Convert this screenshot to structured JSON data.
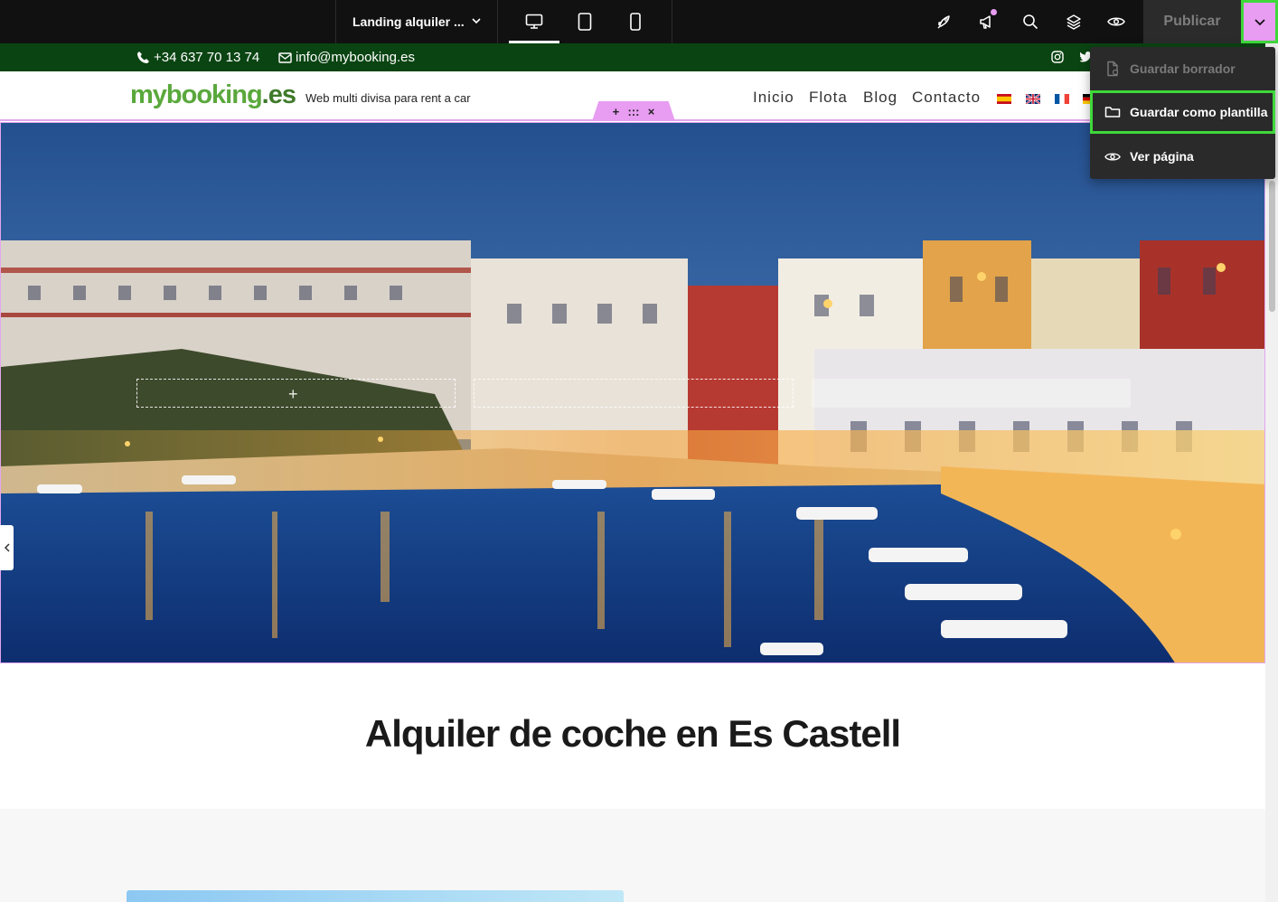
{
  "editor": {
    "page_selector": "Landing alquiler ...",
    "publish_label": "Publicar",
    "menu": [
      {
        "label": "Guardar borrador",
        "disabled": true,
        "icon": "file-icon"
      },
      {
        "label": "Guardar como plantilla",
        "highlighted": true,
        "icon": "folder-icon"
      },
      {
        "label": "Ver página",
        "icon": "eye-icon"
      }
    ],
    "tools": [
      "rocket-icon",
      "megaphone-icon",
      "search-icon",
      "layers-icon",
      "eye-icon"
    ],
    "devices": [
      "desktop-icon",
      "tablet-icon",
      "mobile-icon"
    ],
    "accent": "#e89cf2",
    "highlight": "#3fd83a"
  },
  "site": {
    "phone": "+34 637 70 13 74",
    "email": "info@mybooking.es",
    "logo": {
      "main": "mybooking",
      "suffix": ".es"
    },
    "tagline": "Web multi divisa para rent a car",
    "nav": [
      "Inicio",
      "Flota",
      "Blog",
      "Contacto"
    ],
    "flags": [
      "es-flag",
      "gb-flag",
      "fr-flag",
      "de-flag"
    ],
    "headline": "Alquiler de coche en Es Castell",
    "bar_color": "#0a4412"
  },
  "section_toolbar": {
    "add": "+",
    "drag": ":::",
    "close": "×"
  }
}
